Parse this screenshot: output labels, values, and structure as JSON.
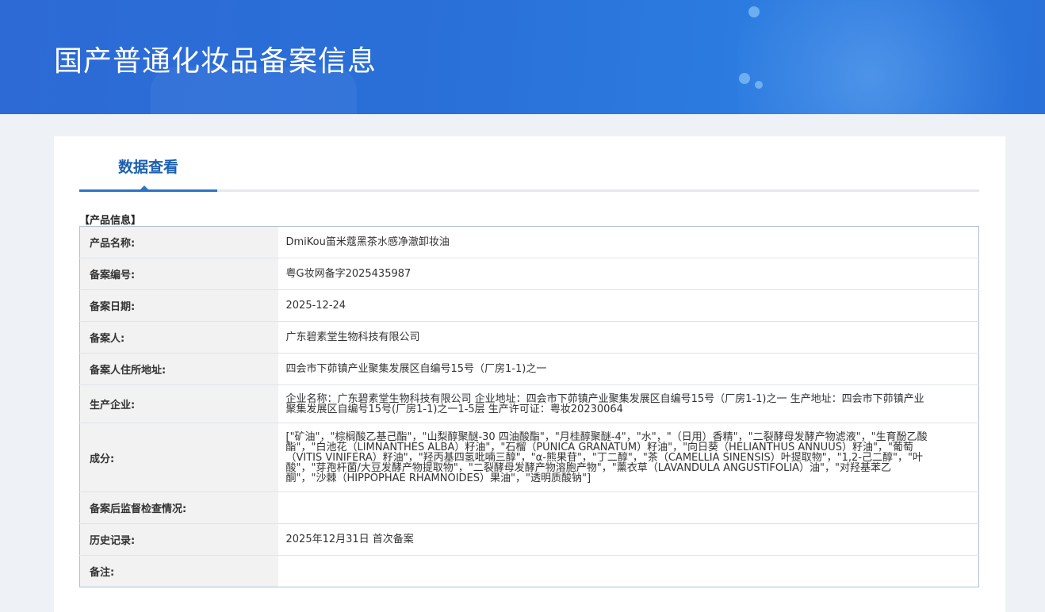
{
  "header": {
    "title": "国产普通化妆品备案信息"
  },
  "tabs": [
    {
      "label": "数据查看",
      "active": true
    }
  ],
  "section": {
    "label": "【产品信息】"
  },
  "rows": [
    {
      "label": "产品名称:",
      "value": "DmiKou笛米蔻黑茶水感净澈卸妆油"
    },
    {
      "label": "备案编号:",
      "value": "粤G妆网备字2025435987"
    },
    {
      "label": "备案日期:",
      "value": "2025-12-24"
    },
    {
      "label": "备案人:",
      "value": "广东碧素堂生物科技有限公司"
    },
    {
      "label": "备案人住所地址:",
      "value": "四会市下茆镇产业聚集发展区自编号15号（厂房1-1)之一"
    },
    {
      "label": "生产企业:",
      "value": "企业名称：广东碧素堂生物科技有限公司 企业地址：四会市下茆镇产业聚集发展区自编号15号（厂房1-1)之一 生产地址：四会市下茆镇产业聚集发展区自编号15号(厂房1-1)之一1-5层 生产许可证：粤妆20230064"
    },
    {
      "label": "成分:",
      "value": "[\"矿油\"，\"棕榈酸乙基己酯\"，\"山梨醇聚醚-30 四油酸酯\"，\"月桂醇聚醚-4\"，\"水\"，\"（日用）香精\"，\"二裂酵母发酵产物滤液\"，\"生育酚乙酸酯\"，\"白池花（LIMNANTHES ALBA）籽油\"，\"石榴（PUNICA GRANATUM）籽油\"，\"向日葵（HELIANTHUS ANNUUS）籽油\"，\"葡萄（VITIS VINIFERA）籽油\"，\"羟丙基四氢吡喃三醇\"，\"α-熊果苷\"，\"丁二醇\"，\"茶（CAMELLIA SINENSIS）叶提取物\"，\"1,2-己二醇\"，\"叶酸\"，\"芽孢杆菌/大豆发酵产物提取物\"，\"二裂酵母发酵产物溶胞产物\"，\"薰衣草（LAVANDULA ANGUSTIFOLIA）油\"，\"对羟基苯乙酮\"，\"沙棘（HIPPOPHAE RHAMNOIDES）果油\"，\"透明质酸钠\"]"
    },
    {
      "label": "备案后监督检查情况:",
      "value": ""
    },
    {
      "label": "历史记录:",
      "value": "2025年12月31日 首次备案"
    },
    {
      "label": "备注:",
      "value": ""
    }
  ],
  "colors": {
    "banner": "#2b72d9",
    "accent": "#2a74c7",
    "tab_text": "#1b5fb0",
    "label_bg": "#f2f2f2"
  }
}
